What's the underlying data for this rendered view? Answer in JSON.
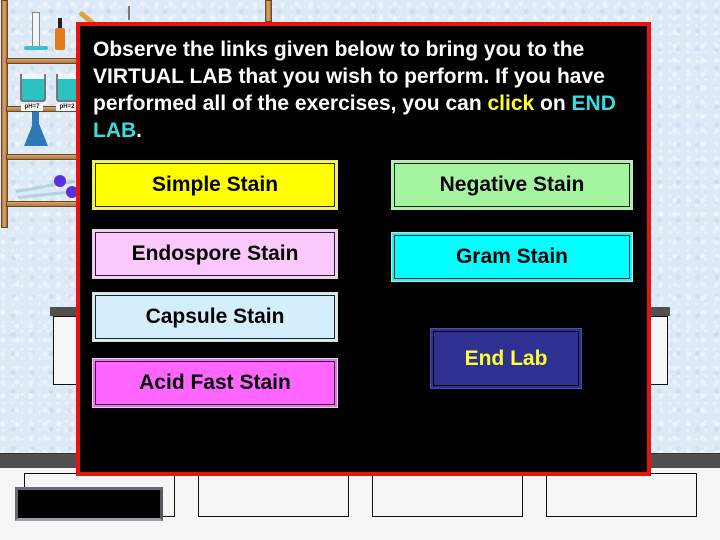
{
  "scene": {
    "ph_labels": [
      "pH=7",
      "pH=2"
    ]
  },
  "dialog": {
    "instruction_part1": "Observe the links given below to bring you to the VIRTUAL LAB that you wish to perform. If you have performed all of the exercises, you can ",
    "instruction_click": "click",
    "instruction_part2": " on ",
    "instruction_end": "END LAB",
    "instruction_part3": ".",
    "buttons": [
      {
        "label": "Simple Stain",
        "color": "#ffff00"
      },
      {
        "label": "Negative Stain",
        "color": "#a5f5a0"
      },
      {
        "label": "Endospore Stain",
        "color": "#fbc8fb"
      },
      {
        "label": "Gram Stain",
        "color": "#00ffff"
      },
      {
        "label": "Capsule Stain",
        "color": "#d4eefc"
      },
      {
        "label": "Acid Fast Stain",
        "color": "#ff66ff"
      }
    ],
    "end_lab_label": "End Lab"
  }
}
